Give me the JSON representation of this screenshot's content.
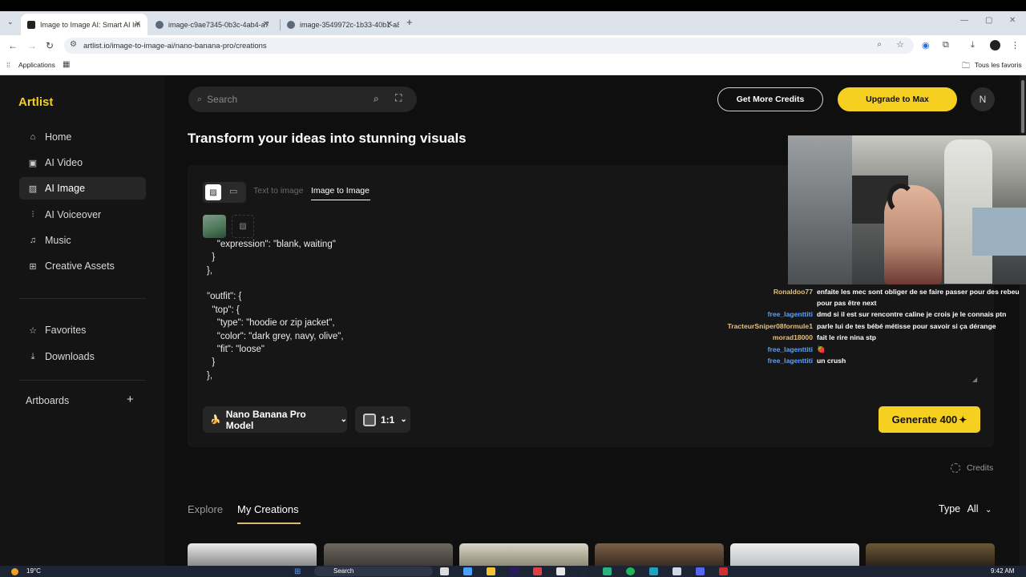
{
  "browser": {
    "tabs": [
      {
        "title": "Image to Image AI: Smart AI Im",
        "active": true
      },
      {
        "title": "image-c9ae7345-0b3c-4ab4-a7",
        "active": false
      },
      {
        "title": "image-3549972c-1b33-40b1-a8",
        "active": false
      }
    ],
    "new_tab": "+",
    "url": "artlist.io/image-to-image-ai/nano-banana-pro/creations",
    "bookmarks": {
      "apps": "Applications",
      "all_favorites": "Tous les favoris"
    }
  },
  "app": {
    "logo": "Artlist",
    "search_placeholder": "Search",
    "get_credits": "Get More Credits",
    "upgrade": "Upgrade to Max",
    "avatar_letter": "N",
    "accent": "#f5d020",
    "nav": [
      {
        "label": "Home",
        "icon": "home-icon"
      },
      {
        "label": "AI Video",
        "icon": "video-icon"
      },
      {
        "label": "AI Image",
        "icon": "image-icon",
        "active": true
      },
      {
        "label": "AI Voiceover",
        "icon": "waveform-icon"
      },
      {
        "label": "Music",
        "icon": "music-note-icon"
      },
      {
        "label": "Creative Assets",
        "icon": "grid-icon"
      }
    ],
    "nav_secondary": [
      {
        "label": "Favorites",
        "icon": "star-icon"
      },
      {
        "label": "Downloads",
        "icon": "download-icon"
      }
    ],
    "artboards": {
      "label": "Artboards",
      "add": "+"
    }
  },
  "generator": {
    "headline": "Transform your ideas into stunning visuals",
    "mode_tabs": [
      "Text to image",
      "Image to Image"
    ],
    "active_mode": "Image to Image",
    "prompt_lines": [
      "    \"expression\": \"blank, waiting\"",
      "  }",
      "},",
      "",
      "\"outfit\": {",
      "  \"top\": {",
      "    \"type\": \"hoodie or zip jacket\",",
      "    \"color\": \"dark grey, navy, olive\",",
      "    \"fit\": \"loose\"",
      "  }",
      "},"
    ],
    "model": "Nano Banana Pro Model",
    "aspect": "1:1",
    "generate_label": "Generate 400",
    "credits_label": "Credits"
  },
  "gallery": {
    "tabs": [
      "Explore",
      "My Creations"
    ],
    "active_tab": "My Creations",
    "type_label": "Type",
    "type_value": "All"
  },
  "overlay_chat": [
    {
      "user": "Ronaldoo77",
      "color": "#e6c07a",
      "msg": "enfaite les mec sont obliger de se faire passer pour des rebeu"
    },
    {
      "user": "",
      "color": "#ffffff",
      "msg": "pour pas être next"
    },
    {
      "user": "free_lagenttiti",
      "color": "#5aa2ff",
      "msg": "dmd si il est sur rencontre caline je crois je le connais ptn"
    },
    {
      "user": "TracteurSniper08formule1",
      "color": "#e6c07a",
      "msg": "parle lui de tes bébé métisse pour savoir si ça dérange"
    },
    {
      "user": "morad18000",
      "color": "#e6c07a",
      "msg": "fait le rire nina stp"
    },
    {
      "user": "free_lagenttiti",
      "color": "#5aa2ff",
      "msg": "🍓"
    },
    {
      "user": "free_lagenttiti",
      "color": "#5aa2ff",
      "msg": "un crush"
    }
  ],
  "taskbar": {
    "weather": "19°C",
    "search": "Search",
    "time": "9:42 AM"
  }
}
